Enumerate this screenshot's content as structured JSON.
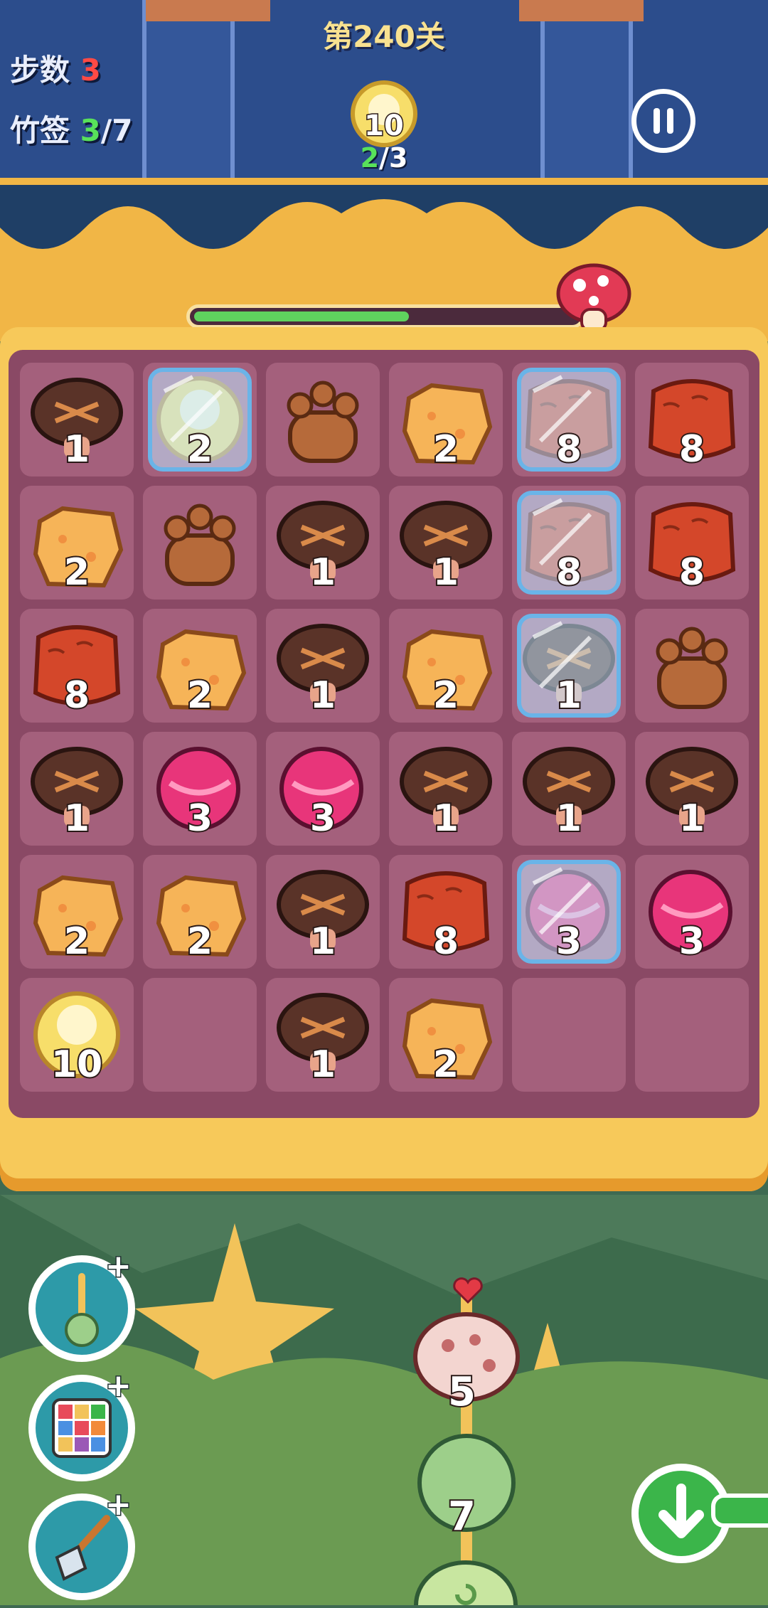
{
  "header": {
    "level_title": "第240关",
    "steps_label": "步数",
    "steps_value": "3",
    "skewers_label": "竹签",
    "skewers_current": "3",
    "skewers_separator": "/",
    "skewers_total": "7",
    "goal_value": "10",
    "goal_progress_current": "2",
    "goal_progress_separator": "/",
    "goal_progress_total": "3"
  },
  "progress": {
    "fraction": 0.56
  },
  "board": {
    "rows": [
      [
        {
          "type": "mushroom",
          "n": "1",
          "ice": false
        },
        {
          "type": "corn",
          "n": "2",
          "ice": true
        },
        {
          "type": "paw",
          "n": "",
          "ice": false
        },
        {
          "type": "tofu",
          "n": "2",
          "ice": false
        },
        {
          "type": "sausage",
          "n": "8",
          "ice": true
        },
        {
          "type": "sausage",
          "n": "8",
          "ice": false
        }
      ],
      [
        {
          "type": "tofu",
          "n": "2",
          "ice": false
        },
        {
          "type": "paw",
          "n": "",
          "ice": false
        },
        {
          "type": "mushroom",
          "n": "1",
          "ice": false
        },
        {
          "type": "mushroom",
          "n": "1",
          "ice": false
        },
        {
          "type": "sausage",
          "n": "8",
          "ice": true
        },
        {
          "type": "sausage",
          "n": "8",
          "ice": false
        }
      ],
      [
        {
          "type": "sausage",
          "n": "8",
          "ice": false
        },
        {
          "type": "tofu",
          "n": "2",
          "ice": false
        },
        {
          "type": "mushroom",
          "n": "1",
          "ice": false
        },
        {
          "type": "tofu",
          "n": "2",
          "ice": false
        },
        {
          "type": "mushroom",
          "n": "1",
          "ice": true
        },
        {
          "type": "paw",
          "n": "",
          "ice": false
        }
      ],
      [
        {
          "type": "mushroom",
          "n": "1",
          "ice": false
        },
        {
          "type": "candy",
          "n": "3",
          "ice": false
        },
        {
          "type": "candy",
          "n": "3",
          "ice": false
        },
        {
          "type": "mushroom",
          "n": "1",
          "ice": false
        },
        {
          "type": "mushroom",
          "n": "1",
          "ice": false
        },
        {
          "type": "mushroom",
          "n": "1",
          "ice": false
        }
      ],
      [
        {
          "type": "tofu",
          "n": "2",
          "ice": false
        },
        {
          "type": "tofu",
          "n": "2",
          "ice": false
        },
        {
          "type": "mushroom",
          "n": "1",
          "ice": false
        },
        {
          "type": "sausage",
          "n": "8",
          "ice": false
        },
        {
          "type": "candy",
          "n": "3",
          "ice": true
        },
        {
          "type": "candy",
          "n": "3",
          "ice": false
        }
      ],
      [
        {
          "type": "corn",
          "n": "10",
          "ice": false
        },
        {
          "type": "empty",
          "n": "",
          "ice": false
        },
        {
          "type": "mushroom",
          "n": "1",
          "ice": false
        },
        {
          "type": "tofu",
          "n": "2",
          "ice": false
        },
        {
          "type": "empty",
          "n": "",
          "ice": false
        },
        {
          "type": "empty",
          "n": "",
          "ice": false
        }
      ]
    ]
  },
  "tools": {
    "plus": "+"
  },
  "skewer": {
    "top_value": "5",
    "middle_value": "7"
  },
  "colors": {
    "mushroom": "#5a3328",
    "tofu": "#f6b458",
    "sausage": "#d4472a",
    "candy": "#e8357a",
    "paw": "#b66a3a",
    "corn": "#f7de6a",
    "ice": "#bfe6ff"
  }
}
